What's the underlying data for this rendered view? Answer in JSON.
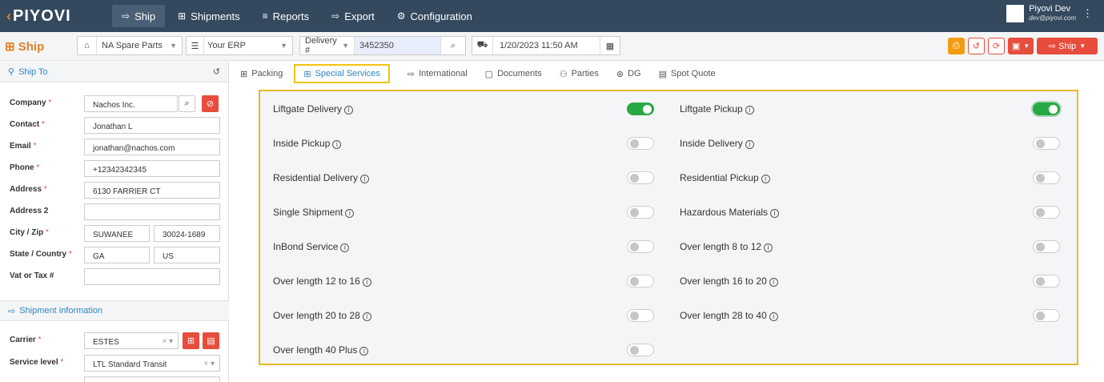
{
  "brand": "PIYOVI",
  "nav": [
    {
      "label": "Ship",
      "icon": "ship-icon",
      "glyph": "⇨"
    },
    {
      "label": "Shipments",
      "icon": "shipments-icon",
      "glyph": "⊞"
    },
    {
      "label": "Reports",
      "icon": "reports-icon",
      "glyph": "≡"
    },
    {
      "label": "Export",
      "icon": "export-icon",
      "glyph": "⇨"
    },
    {
      "label": "Configuration",
      "icon": "gear-icon",
      "glyph": "⚙"
    }
  ],
  "user": {
    "name": "Piyovi Dev",
    "email": "dev@piyovi.com"
  },
  "toolbar": {
    "title": "Ship",
    "location": "NA Spare Parts",
    "erp": "Your ERP",
    "ref_type": "Delivery #",
    "ref_value": "3452350",
    "ship_date": "1/20/2023 11:50 AM",
    "ship_label": "Ship"
  },
  "ship_to": {
    "header": "Ship To",
    "fields": [
      {
        "label": "Company",
        "required": "*",
        "value": "Nachos Inc."
      },
      {
        "label": "Contact",
        "required": "*",
        "value": "Jonathan L"
      },
      {
        "label": "Email",
        "required": "*",
        "value": "jonathan@nachos.com"
      },
      {
        "label": "Phone",
        "required": "*",
        "value": "+12342342345"
      },
      {
        "label": "Address",
        "required": "*",
        "value": "6130 FARRIER CT"
      },
      {
        "label": "Address 2",
        "required": "",
        "value": ""
      },
      {
        "label": "City / Zip",
        "required": "*",
        "value": "SUWANEE",
        "value2": "30024-1689"
      },
      {
        "label": "State / Country",
        "required": "*",
        "value": "GA",
        "value2": "US"
      },
      {
        "label": "Vat or Tax #",
        "required": "",
        "value": ""
      }
    ]
  },
  "shipment_info": {
    "header": "Shipment information",
    "carrier_label": "Carrier",
    "carrier_required": "*",
    "carrier": "ESTES",
    "service_label": "Service level",
    "service_required": "*",
    "service": "LTL Standard Transit"
  },
  "tabs": [
    {
      "label": "Packing",
      "icon": "packing-icon",
      "glyph": "⊞"
    },
    {
      "label": "Special Services",
      "icon": "special-services-icon",
      "glyph": "⊞",
      "active": true
    },
    {
      "label": "International",
      "icon": "international-icon",
      "glyph": "⇨"
    },
    {
      "label": "Documents",
      "icon": "documents-icon",
      "glyph": "▢"
    },
    {
      "label": "Parties",
      "icon": "parties-icon",
      "glyph": "⚇"
    },
    {
      "label": "DG",
      "icon": "dg-icon",
      "glyph": "⊛"
    },
    {
      "label": "Spot Quote",
      "icon": "spot-quote-icon",
      "glyph": "▤"
    }
  ],
  "services": [
    {
      "label": "Liftgate Delivery",
      "on": true
    },
    {
      "label": "Liftgate Pickup",
      "on": true
    },
    {
      "label": "Inside Pickup",
      "on": false
    },
    {
      "label": "Inside Delivery",
      "on": false
    },
    {
      "label": "Residential Delivery",
      "on": false
    },
    {
      "label": "Residential Pickup",
      "on": false
    },
    {
      "label": "Single Shipment",
      "on": false
    },
    {
      "label": "Hazardous Materials",
      "on": false
    },
    {
      "label": "InBond Service",
      "on": false
    },
    {
      "label": "Over length 8 to 12",
      "on": false
    },
    {
      "label": "Over length 12 to 16",
      "on": false
    },
    {
      "label": "Over length 16 to 20",
      "on": false
    },
    {
      "label": "Over length 20 to 28",
      "on": false
    },
    {
      "label": "Over length 28 to 40",
      "on": false
    },
    {
      "label": "Over length 40 Plus",
      "on": false
    }
  ]
}
